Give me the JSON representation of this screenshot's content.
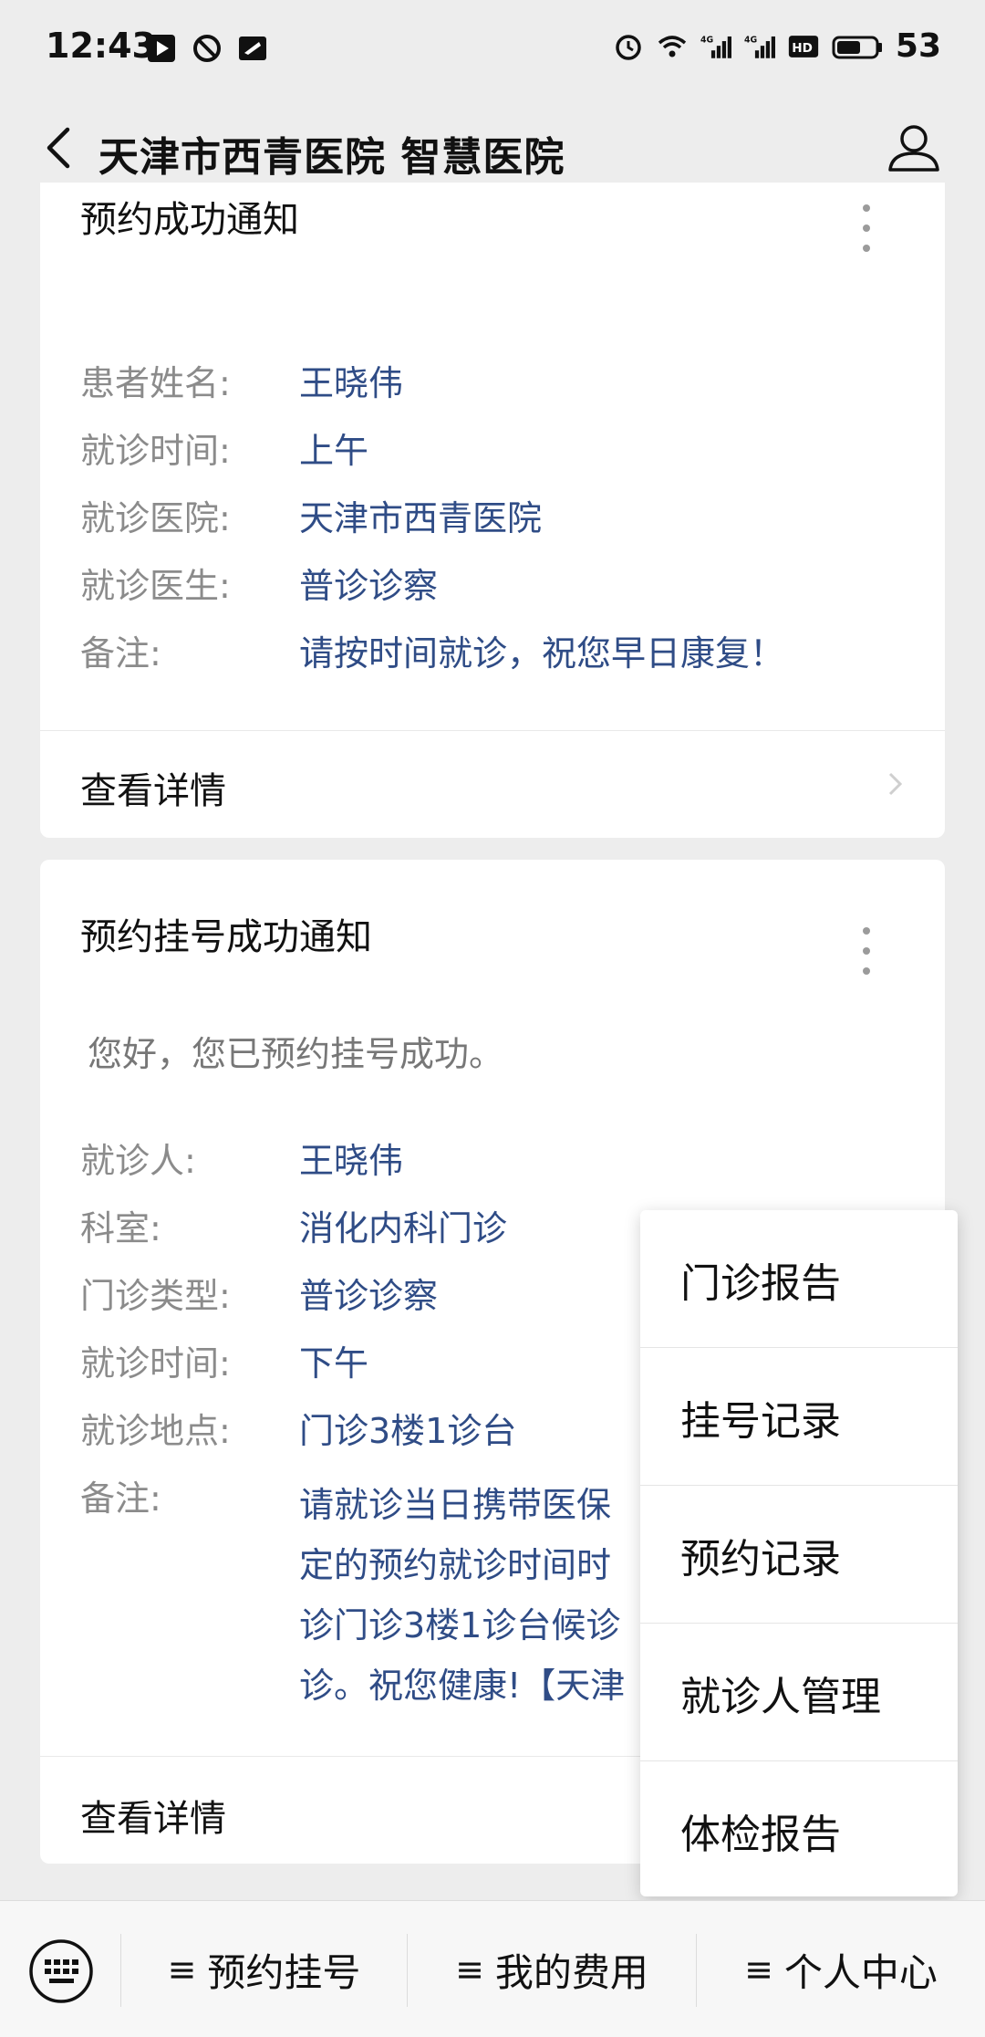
{
  "status_bar": {
    "time": "12:43",
    "battery": "53",
    "network_labels": [
      "4G",
      "4G"
    ],
    "hd_label": "HD2"
  },
  "navbar": {
    "title": "天津市西青医院 智慧医院"
  },
  "card1": {
    "title": "预约成功通知",
    "fields": [
      {
        "label": "患者姓名:",
        "value": "王晓伟"
      },
      {
        "label": "就诊时间:",
        "value": "上午"
      },
      {
        "label": "就诊医院:",
        "value": "天津市西青医院"
      },
      {
        "label": "就诊医生:",
        "value": "普诊诊察"
      },
      {
        "label": "备注:",
        "value": "请按时间就诊，祝您早日康复！"
      }
    ],
    "detail_label": "查看详情"
  },
  "card2": {
    "title": "预约挂号成功通知",
    "greeting": "您好，您已预约挂号成功。",
    "fields": [
      {
        "label": "就诊人:",
        "value": "王晓伟"
      },
      {
        "label": "科室:",
        "value": "消化内科门诊"
      },
      {
        "label": "门诊类型:",
        "value": "普诊诊察"
      },
      {
        "label": "就诊时间:",
        "value": "下午"
      },
      {
        "label": "就诊地点:",
        "value": "门诊3楼1诊台"
      },
      {
        "label": "备注:",
        "value": "请就诊当日携带医保卡定的预约就诊时间时到诊门诊3楼1诊台候诊诊。祝您健康!【天津"
      }
    ],
    "remark_lines": [
      "请就诊当日携带医保",
      "定的预约就诊时间时",
      "诊门诊3楼1诊台候诊",
      "诊。祝您健康!【天津"
    ],
    "detail_label": "查看详情"
  },
  "popup_menu": {
    "items": [
      "门诊报告",
      "挂号记录",
      "预约记录",
      "就诊人管理",
      "体检报告"
    ]
  },
  "bottom_menu": {
    "items": [
      "预约挂号",
      "我的费用",
      "个人中心"
    ],
    "hamburger": "≡"
  },
  "colors": {
    "background": "#ededed",
    "card": "#ffffff",
    "value_text": "#2f4c86",
    "label_text": "#8b8b8b"
  }
}
